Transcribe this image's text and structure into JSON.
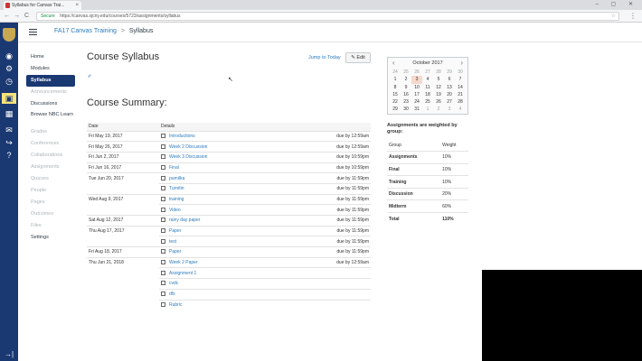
{
  "browser": {
    "tab_title": "Syllabus for Canvas Trai...",
    "tab_close": "×",
    "window_controls": "– ▢ ✕",
    "back": "←",
    "forward": "→",
    "reload": "C",
    "secure_label": "Secure",
    "url": "https://canvas.sjcny.edu/courses/5723/assignments/syllabus",
    "star": "☆",
    "menu": "⋮"
  },
  "header": {
    "course": "FA17 Canvas Training",
    "separator": ">",
    "page": "Syllabus"
  },
  "course_nav": [
    {
      "label": "Home",
      "state": "normal"
    },
    {
      "label": "Modules",
      "state": "normal"
    },
    {
      "label": "Syllabus",
      "state": "active"
    },
    {
      "label": "Announcements",
      "state": "disabled"
    },
    {
      "label": "Discussions",
      "state": "normal"
    },
    {
      "label": "Browse NBC Learn",
      "state": "normal"
    },
    {
      "label": "Grades",
      "state": "disabled"
    },
    {
      "label": "Conferences",
      "state": "disabled"
    },
    {
      "label": "Collaborations",
      "state": "disabled"
    },
    {
      "label": "Assignments",
      "state": "disabled"
    },
    {
      "label": "Quizzes",
      "state": "disabled"
    },
    {
      "label": "People",
      "state": "disabled"
    },
    {
      "label": "Pages",
      "state": "disabled"
    },
    {
      "label": "Outcomes",
      "state": "disabled"
    },
    {
      "label": "Files",
      "state": "disabled"
    },
    {
      "label": "Settings",
      "state": "normal"
    }
  ],
  "main": {
    "title": "Course Syllabus",
    "jump_to_today": "Jump to Today",
    "edit_button": "✎ Edit",
    "edit_link": "✐",
    "summary_heading": "Course Summary:",
    "col_date": "Date",
    "col_details": "Details"
  },
  "summary_rows": [
    {
      "date": "Fri May 19, 2017",
      "name": "Introductions",
      "due": "due by 12:59am"
    },
    {
      "date": "Fri May 26, 2017",
      "name": "Week 2 Discussion",
      "due": "due by 12:59am"
    },
    {
      "date": "Fri Jun 2, 2017",
      "name": "Week 3 Discussion",
      "due": "due by 10:59pm"
    },
    {
      "date": "Fri Jun 16, 2017",
      "name": "Final",
      "due": "due by 10:59pm"
    },
    {
      "date": "Tue Jun 20, 2017",
      "name": "pumilka",
      "due": "due by 11:59pm"
    },
    {
      "date": "",
      "name": "Turnitin",
      "due": "due by 11:59pm"
    },
    {
      "date": "Wed Aug 9, 2017",
      "name": "training",
      "due": "due by 11:59pm"
    },
    {
      "date": "",
      "name": "Video",
      "due": "due by 11:59pm"
    },
    {
      "date": "Sat Aug 12, 2017",
      "name": "rainy day paper",
      "due": "due by 11:59pm"
    },
    {
      "date": "Thu Aug 17, 2017",
      "name": "Paper",
      "due": "due by 11:59pm"
    },
    {
      "date": "",
      "name": "test",
      "due": "due by 11:59pm"
    },
    {
      "date": "Fri Aug 18, 2017",
      "name": "Paper",
      "due": "due by 11:59pm"
    },
    {
      "date": "Thu Jun 21, 2018",
      "name": "Week 2 Paper",
      "due": "due by 12:59am"
    },
    {
      "date": "",
      "name": "Assignment 1",
      "due": ""
    },
    {
      "date": "",
      "name": "cvdc",
      "due": ""
    },
    {
      "date": "",
      "name": "dfs",
      "due": ""
    },
    {
      "date": "",
      "name": "Rubric",
      "due": ""
    }
  ],
  "calendar": {
    "month": "October 2017",
    "prev": "‹",
    "next": "›",
    "days": [
      {
        "d": "24",
        "dim": true
      },
      {
        "d": "25",
        "dim": true
      },
      {
        "d": "26",
        "dim": true
      },
      {
        "d": "27",
        "dim": true
      },
      {
        "d": "28",
        "dim": true
      },
      {
        "d": "29",
        "dim": true
      },
      {
        "d": "30",
        "dim": true
      },
      {
        "d": "1"
      },
      {
        "d": "2"
      },
      {
        "d": "3",
        "today": true
      },
      {
        "d": "4"
      },
      {
        "d": "5"
      },
      {
        "d": "6"
      },
      {
        "d": "7"
      },
      {
        "d": "8"
      },
      {
        "d": "9"
      },
      {
        "d": "10"
      },
      {
        "d": "11"
      },
      {
        "d": "12"
      },
      {
        "d": "13"
      },
      {
        "d": "14"
      },
      {
        "d": "15"
      },
      {
        "d": "16"
      },
      {
        "d": "17"
      },
      {
        "d": "18"
      },
      {
        "d": "19"
      },
      {
        "d": "20"
      },
      {
        "d": "21"
      },
      {
        "d": "22"
      },
      {
        "d": "23"
      },
      {
        "d": "24"
      },
      {
        "d": "25"
      },
      {
        "d": "26"
      },
      {
        "d": "27"
      },
      {
        "d": "28"
      },
      {
        "d": "29"
      },
      {
        "d": "30"
      },
      {
        "d": "31"
      },
      {
        "d": "1",
        "dim": true
      },
      {
        "d": "2",
        "dim": true
      },
      {
        "d": "3",
        "dim": true
      },
      {
        "d": "4",
        "dim": true
      }
    ]
  },
  "weights": {
    "title": "Assignments are weighted by group:",
    "col_group": "Group",
    "col_weight": "Weight",
    "rows": [
      {
        "group": "Assignments",
        "weight": "10%"
      },
      {
        "group": "Final",
        "weight": "10%"
      },
      {
        "group": "Training",
        "weight": "10%"
      },
      {
        "group": "Discussion",
        "weight": "20%"
      },
      {
        "group": "Midterm",
        "weight": "60%"
      },
      {
        "group": "Total",
        "weight": "110%"
      }
    ]
  },
  "global_nav_icons": [
    "account-icon",
    "admin-icon",
    "dashboard-icon",
    "courses-icon",
    "calendar-icon",
    "inbox-icon",
    "commons-icon",
    "help-icon"
  ],
  "global_nav_glyphs": [
    "◉",
    "⚙",
    "◷",
    "▣",
    "▦",
    "✉",
    "↪",
    "?"
  ],
  "global_nav_bottom": "→|",
  "colors": {
    "nav_bg": "#1a3872",
    "link": "#2b7abc",
    "active_icon_bg": "#f5e27a"
  }
}
